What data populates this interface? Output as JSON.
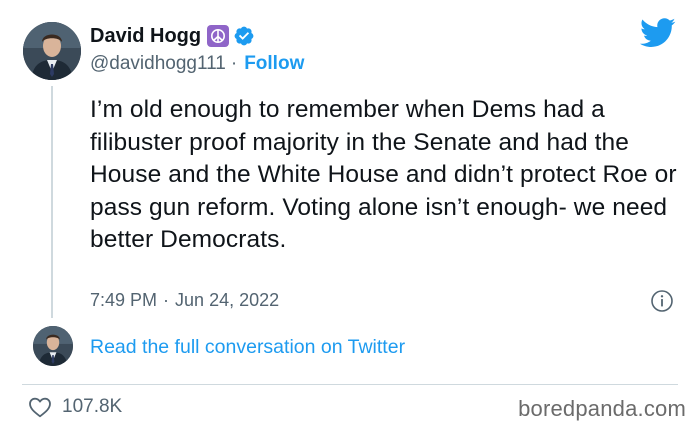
{
  "author": {
    "name": "David Hogg",
    "handle": "@davidhogg111",
    "separator": "·",
    "follow_label": "Follow",
    "emoji": "peace-symbol-icon",
    "verified": "verified-badge-icon"
  },
  "tweet": {
    "text": "I’m old enough to remember when Dems had a filibuster proof majority in the Senate and had the House and the White House and didn’t protect Roe or pass gun reform. Voting alone isn’t enough- we need better Democrats.",
    "time": "7:49 PM",
    "separator": "·",
    "date": "Jun 24, 2022"
  },
  "conversation": {
    "link_label": "Read the full conversation on Twitter"
  },
  "engagement": {
    "likes": "107.8K"
  },
  "watermark": "boredpanda.com",
  "colors": {
    "accent": "#1d9bf0",
    "text_primary": "#0f1419",
    "text_secondary": "#536471",
    "emoji_bg": "#8f65c8"
  }
}
